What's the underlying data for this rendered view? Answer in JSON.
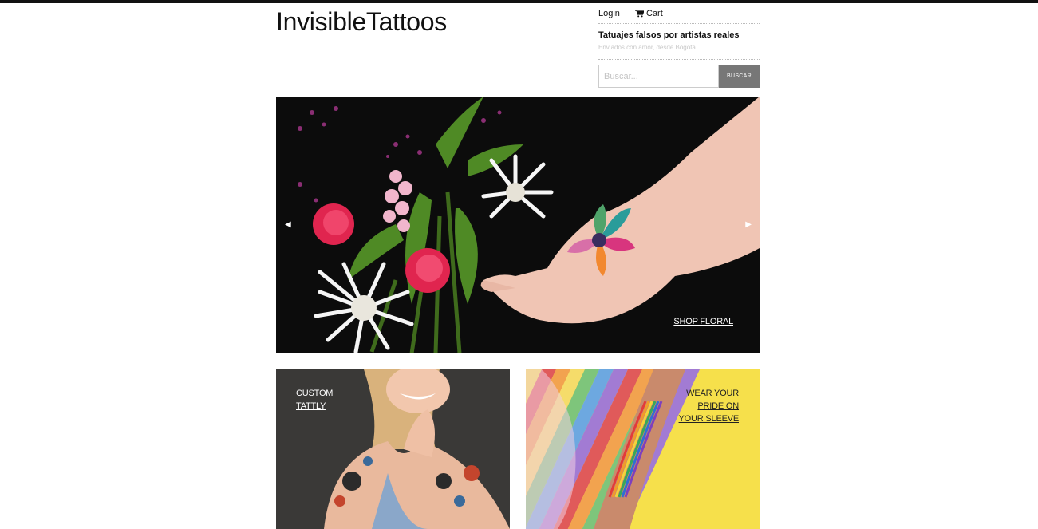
{
  "header": {
    "logo": "InvisibleTattoos",
    "login": "Login",
    "cart": "Cart",
    "tagline": "Tatuajes falsos por artistas reales",
    "subtagline": "Enviados con amor, desde Bogota",
    "search": {
      "placeholder": "Buscar...",
      "button": "BUSCAR"
    }
  },
  "hero": {
    "cta": "SHOP FLORAL",
    "prev_icon": "arrow-left-icon",
    "next_icon": "arrow-right-icon"
  },
  "tiles": [
    {
      "lines": [
        "CUSTOM",
        "TATTLY"
      ]
    },
    {
      "lines": [
        "WEAR YOUR",
        "PRIDE ON",
        "YOUR SLEEVE"
      ]
    }
  ],
  "colors": {
    "topbar": "#111111",
    "search_button": "#777777",
    "pride_bg": "#f6e04b"
  }
}
